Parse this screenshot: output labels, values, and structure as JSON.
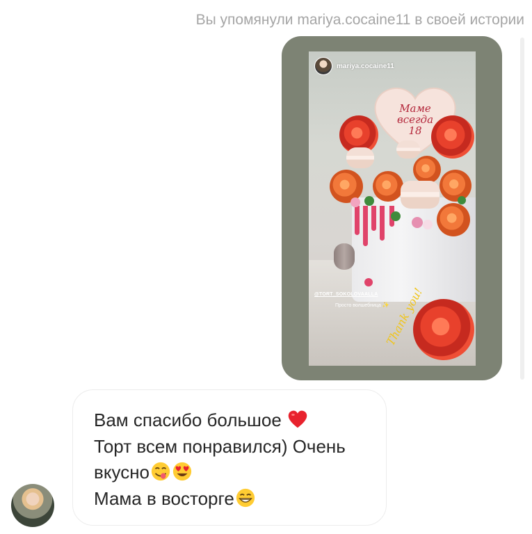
{
  "mention_notice": "Вы упомянули mariya.cocaine11 в своей истории",
  "story": {
    "username": "mariya.cocaine11",
    "topper_text": [
      "Маме",
      "всегда",
      "18"
    ],
    "mention_tag": "@TORT_SOKOLOVAALLA",
    "caption": "Просто волшебница",
    "sticker_text": "Thank you!"
  },
  "message": {
    "lines": [
      "Вам спасибо большое",
      "Торт всем понравился) Очень",
      "вкусно",
      "Мама в восторге"
    ],
    "emoji_icons": [
      "red-heart-icon",
      "yum-face-icon",
      "heart-eyes-face-icon",
      "grinning-face-icon"
    ]
  },
  "colors": {
    "story_frame": "#7d8374",
    "notice_text": "#a5a5a5",
    "message_text": "#262626",
    "bubble_border": "#ececec"
  }
}
